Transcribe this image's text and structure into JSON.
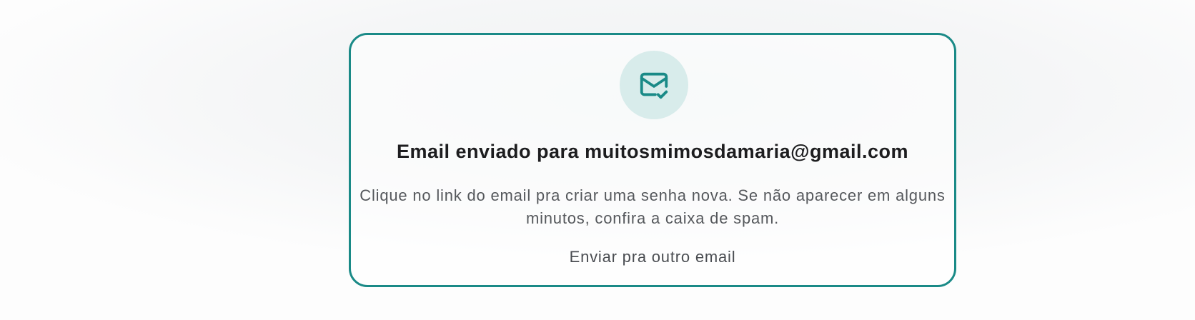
{
  "card": {
    "title": "Email enviado para muitosmimosdamaria@gmail.com",
    "message": "Clique no link do email pra criar uma senha nova. Se não aparecer em alguns minutos, confira a caixa de spam.",
    "resend_link_label": "Enviar pra outro email",
    "icon": "mail-check-icon"
  },
  "colors": {
    "accent": "#1a8a87",
    "icon_background": "#d8eceb",
    "title_text": "#1d1d1f",
    "body_text": "#55585c"
  }
}
